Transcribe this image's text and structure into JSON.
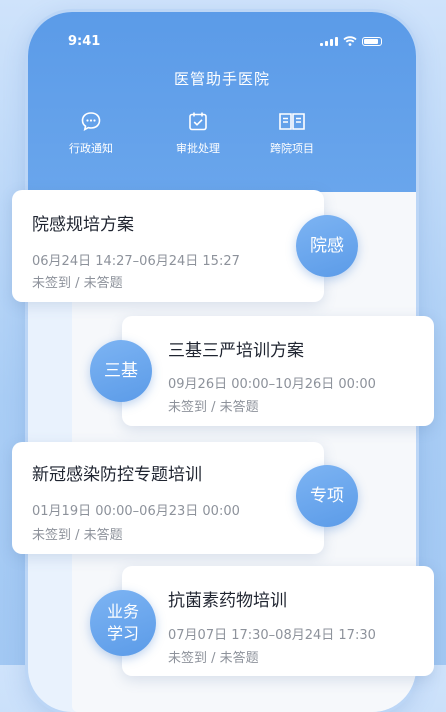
{
  "status_bar": {
    "time": "9:41"
  },
  "header": {
    "title": "医管助手医院"
  },
  "nav": [
    {
      "label": "行政通知",
      "icon": "chat-bubble-icon"
    },
    {
      "label": "审批处理",
      "icon": "calendar-check-icon"
    },
    {
      "label": "跨院项目",
      "icon": "book-icon"
    }
  ],
  "cards": [
    {
      "title": "院感规培方案",
      "time": "06月24日 14:27–06月24日 15:27",
      "status": "未签到 / 未答题",
      "badge": "院感"
    },
    {
      "title": "三基三严培训方案",
      "time": "09月26日 00:00–10月26日 00:00",
      "status": "未签到 / 未答题",
      "badge": "三基"
    },
    {
      "title": "新冠感染防控专题培训",
      "time": "01月19日 00:00–06月23日 00:00",
      "status": "未签到 / 未答题",
      "badge": "专项"
    },
    {
      "title": "抗菌素药物培训",
      "time": "07月07日 17:30–08月24日 17:30",
      "status": "未签到 / 未答题",
      "badge": "业务学习"
    }
  ],
  "colors": {
    "primary": "#5b9be8",
    "background": "#cfe3fb"
  }
}
